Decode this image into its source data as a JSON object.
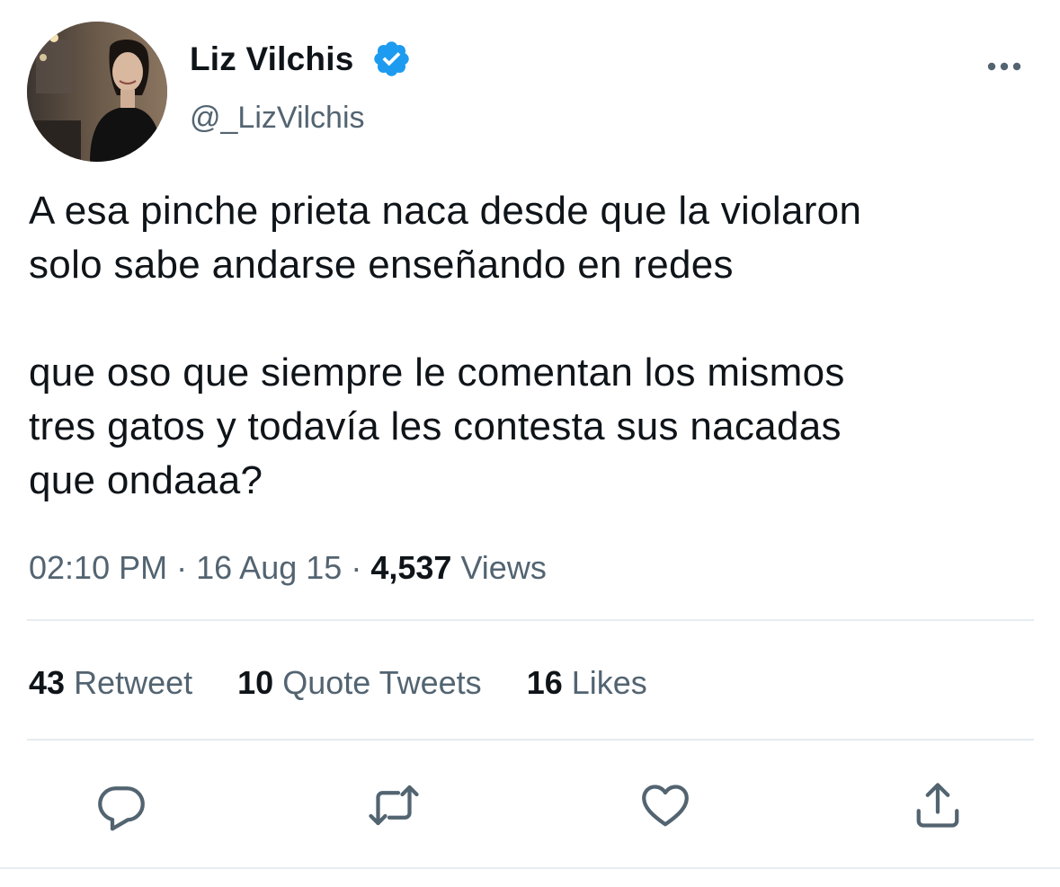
{
  "profile": {
    "display_name": "Liz Vilchis",
    "handle": "@_LizVilchis",
    "verified": true
  },
  "tweet": {
    "lines": [
      "A esa pinche prieta naca desde que la violaron",
      "solo sabe andarse enseñando en redes",
      "",
      "que oso que siempre le comentan los mismos",
      "tres gatos y todavía les contesta sus nacadas",
      "que ondaaa?"
    ]
  },
  "meta": {
    "time": "02:10 PM",
    "separator": "·",
    "date": "16 Aug 15",
    "views_count": "4,537",
    "views_label": "Views"
  },
  "stats": {
    "retweets": {
      "count": "43",
      "label": "Retweet"
    },
    "quotes": {
      "count": "10",
      "label": "Quote Tweets"
    },
    "likes": {
      "count": "16",
      "label": "Likes"
    }
  },
  "icons": {
    "more": "more-horizontal-icon",
    "reply": "reply-icon",
    "retweet": "retweet-icon",
    "like": "heart-icon",
    "share": "share-icon",
    "verified": "verified-badge-icon"
  },
  "colors": {
    "text": "#0f1419",
    "secondary": "#536471",
    "verified": "#1d9bf0",
    "divider": "#e6ecf0"
  }
}
